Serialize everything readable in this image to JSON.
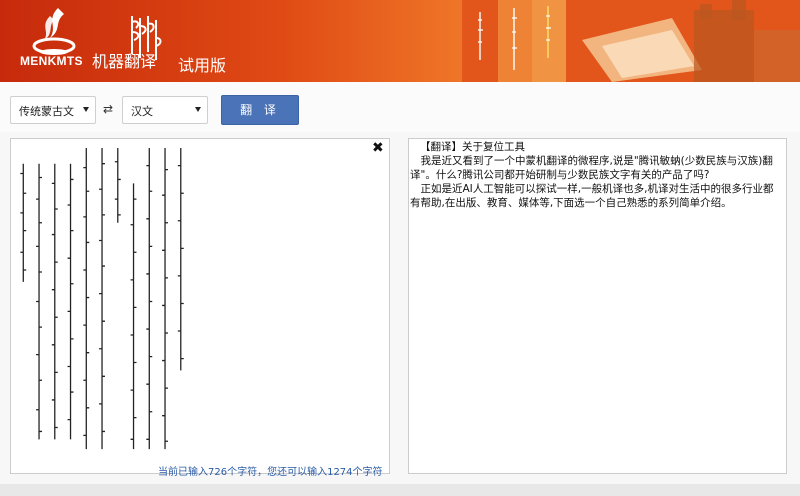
{
  "header": {
    "logo_text": "MENKMTS",
    "brand_label": "机器翻译",
    "trial_label": "试用版",
    "brand_color": "#d2401a"
  },
  "toolbar": {
    "source_lang": "传统蒙古文",
    "target_lang": "汉文",
    "swap_icon": "⇄",
    "translate_label": "翻 译"
  },
  "input_panel": {
    "clear_icon": "✖",
    "counter_text": "当前已输入726个字符，您还可以输入1274个字符"
  },
  "output_panel": {
    "lines": [
      "【翻译】关于复位工具",
      "　我是近又看到了一个中蒙机翻译的微程序,说是\"腾讯敏蚋(少数民族与汉族)翻译\"。什么?腾讯公司都开始研制与少数民族文字有关的产品了吗?",
      "　正如是近AI人工智能可以探试一样,一般机译也多,机译对生活中的很多行业都有帮助,在出版、教育、媒体等,下面选一个自己熟悉的系列简单介绍。"
    ]
  },
  "colors": {
    "accent": "#4a73b8",
    "counter": "#2a5ba7"
  }
}
